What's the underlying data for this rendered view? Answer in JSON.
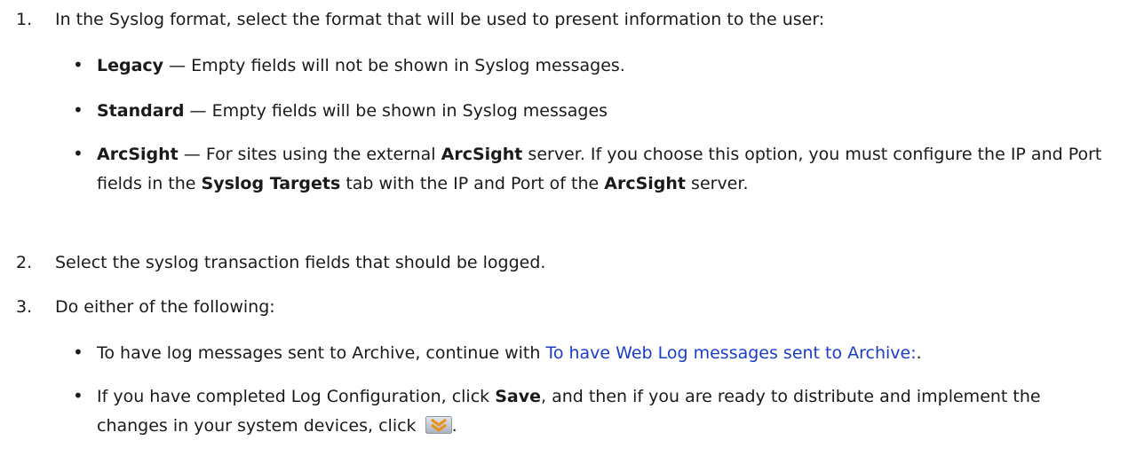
{
  "steps": [
    {
      "num": "1.",
      "text": "In the Syslog format, select the format that will be used to present information to the user:",
      "bullets": [
        {
          "bold": "Legacy",
          "text": " — Empty fields will not be shown in Syslog messages."
        },
        {
          "bold": "Standard",
          "text": " — Empty fields will be shown in Syslog messages"
        },
        {
          "bold": "ArcSight",
          "t1": " — For sites using the external ",
          "b2": "ArcSight",
          "t2": " server. If you choose this option, you must configure the IP and Port fields in the ",
          "b3": "Syslog Targets",
          "t3": " tab with the IP and Port of the ",
          "b4": "ArcSight",
          "t4": " server."
        }
      ]
    },
    {
      "num": "2.",
      "text": "Select the syslog transaction fields that should be logged."
    },
    {
      "num": "3.",
      "text": "Do either of the following:",
      "bullets": [
        {
          "t1": "To have log messages sent to Archive, continue with ",
          "link": "To have Web Log messages sent to Archive:",
          "t2": "."
        },
        {
          "t1": "If you have completed Log Configuration, click ",
          "b1": "Save",
          "t2": ", and then if you are ready to distribute and implement the changes in your system devices, click ",
          "icon": "deploy-chevrons-icon",
          "t3": "."
        }
      ]
    }
  ]
}
